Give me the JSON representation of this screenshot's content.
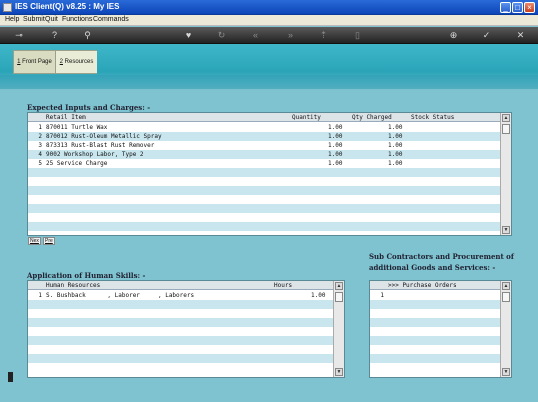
{
  "window": {
    "title": "IES Client(Q) v8.25 : My IES",
    "minimize": "_",
    "maximize": "□",
    "close": "×"
  },
  "menu": [
    "Help",
    "Submit",
    "Quit",
    "Functions",
    "Commands"
  ],
  "tabs": [
    {
      "key": "1",
      "label": " Front Page"
    },
    {
      "key": "2",
      "label": " Resources"
    }
  ],
  "inputs": {
    "section_title": "Expected Inputs and Charges: -",
    "columns": {
      "item": "Retail Item",
      "qty": "Quantity",
      "charged": "Qty Charged",
      "status": "Stock Status"
    },
    "rows": [
      {
        "n": "1",
        "item": "870011 Turtle Wax",
        "qty": "1.00",
        "charged": "1.00"
      },
      {
        "n": "2",
        "item": "870012 Rust-Oleum Metallic Spray",
        "qty": "1.00",
        "charged": "1.00"
      },
      {
        "n": "3",
        "item": "873313 Rust-Blast Rust Remover",
        "qty": "1.00",
        "charged": "1.00"
      },
      {
        "n": "4",
        "item": "9002 Workshop Labor, Type 2",
        "qty": "1.00",
        "charged": "1.00"
      },
      {
        "n": "5",
        "item": "25 Service Charge",
        "qty": "1.00",
        "charged": "1.00"
      }
    ],
    "nav_next": "Nex",
    "nav_prev": "Pre"
  },
  "skills": {
    "section_title": "Application of Human Skills: -",
    "columns": {
      "resource": "Human Resources",
      "hours": "Hours"
    },
    "rows": [
      {
        "n": "1",
        "resource": "S. Bushback      , Laborer     , Laborers",
        "hours": "1.00"
      }
    ]
  },
  "subcontract": {
    "section_title_1": "Sub Contractors and Procurement of",
    "section_title_2": "additional Goods and Services: -",
    "column": ">>> Purchase Orders",
    "rows": [
      {
        "n": "1"
      }
    ]
  }
}
